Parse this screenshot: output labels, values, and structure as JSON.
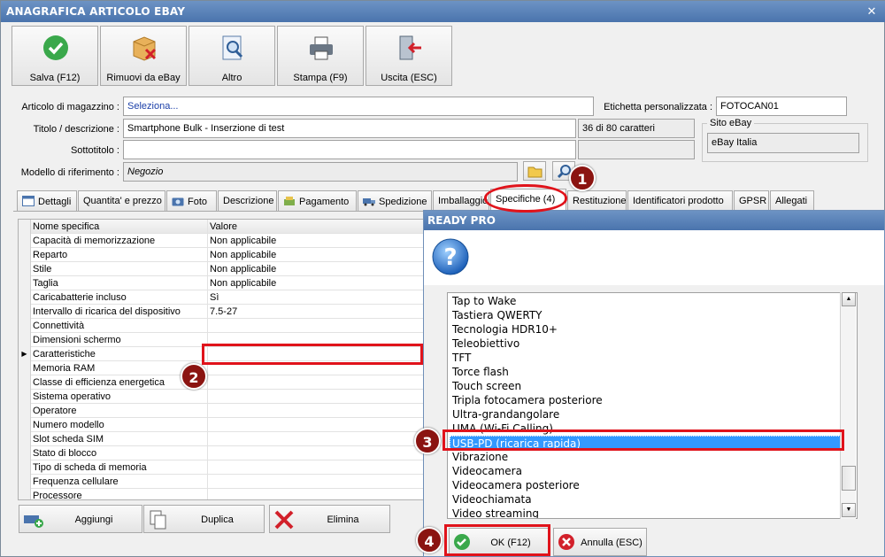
{
  "window": {
    "title": "ANAGRAFICA ARTICOLO EBAY",
    "close_glyph": "✕"
  },
  "toolbar": [
    {
      "label": "Salva (F12)",
      "icon": "save-check-icon"
    },
    {
      "label": "Rimuovi da eBay",
      "icon": "remove-box-icon"
    },
    {
      "label": "Altro",
      "icon": "document-search-icon"
    },
    {
      "label": "Stampa (F9)",
      "icon": "printer-icon"
    },
    {
      "label": "Uscita (ESC)",
      "icon": "exit-door-icon"
    }
  ],
  "form": {
    "articolo_label": "Articolo di magazzino :",
    "articolo_value": "Seleziona...",
    "etichetta_label": "Etichetta personalizzata :",
    "etichetta_value": "FOTOCAN01",
    "titolo_label": "Titolo / descrizione :",
    "titolo_value": "Smartphone Bulk - Inserzione di test",
    "char_count": "36 di 80 caratteri",
    "sito_group": "Sito eBay",
    "sito_value": "eBay Italia",
    "sottotitolo_label": "Sottotitolo :",
    "sottotitolo_value": "",
    "modello_label": "Modello di riferimento :",
    "modello_value": "Negozio"
  },
  "tabs": [
    {
      "label": "Dettagli",
      "icon": "details-icon"
    },
    {
      "label": "Quantita' e prezzo",
      "icon": ""
    },
    {
      "label": "Foto",
      "icon": "camera-icon"
    },
    {
      "label": "Descrizione",
      "icon": ""
    },
    {
      "label": "Pagamento",
      "icon": "payment-icon"
    },
    {
      "label": "Spedizione",
      "icon": "truck-icon"
    },
    {
      "label": "Imballaggio",
      "icon": ""
    },
    {
      "label": "Specifiche (4)",
      "icon": ""
    },
    {
      "label": "Restituzione",
      "icon": ""
    },
    {
      "label": "Identificatori prodotto",
      "icon": ""
    },
    {
      "label": "GPSR",
      "icon": ""
    },
    {
      "label": "Allegati",
      "icon": ""
    }
  ],
  "grid": {
    "headers": [
      "Nome specifica",
      "Valore"
    ],
    "rows": [
      [
        "Capacità di memorizzazione",
        "Non applicabile"
      ],
      [
        "Reparto",
        "Non applicabile"
      ],
      [
        "Stile",
        "Non applicabile"
      ],
      [
        "Taglia",
        "Non applicabile"
      ],
      [
        "Caricabatterie incluso",
        "Sì"
      ],
      [
        "Intervallo di ricarica del dispositivo",
        "7.5-27"
      ],
      [
        "Connettività",
        ""
      ],
      [
        "Dimensioni schermo",
        ""
      ],
      [
        "Caratteristiche",
        ""
      ],
      [
        "Memoria RAM",
        ""
      ],
      [
        "Classe di efficienza energetica",
        ""
      ],
      [
        "Sistema operativo",
        ""
      ],
      [
        "Operatore",
        ""
      ],
      [
        "Numero modello",
        ""
      ],
      [
        "Slot scheda SIM",
        ""
      ],
      [
        "Stato di blocco",
        ""
      ],
      [
        "Tipo di scheda di memoria",
        ""
      ],
      [
        "Frequenza cellulare",
        ""
      ],
      [
        "Processore",
        ""
      ]
    ],
    "current_row_marker": "▶"
  },
  "bottom_buttons": [
    {
      "label": "Aggiungi",
      "icon": "add-row-icon"
    },
    {
      "label": "Duplica",
      "icon": "duplicate-icon"
    },
    {
      "label": "Elimina",
      "icon": "delete-x-icon"
    }
  ],
  "dialog": {
    "title": "READY PRO",
    "icon": "question-icon",
    "items": [
      "Tap to Wake",
      "Tastiera QWERTY",
      "Tecnologia HDR10+",
      "Teleobiettivo",
      "TFT",
      "Torce flash",
      "Touch screen",
      "Tripla fotocamera posteriore",
      "Ultra-grandangolare",
      "UMA (Wi-Fi Calling)",
      "USB-PD (ricarica rapida)",
      "Vibrazione",
      "Videocamera",
      "Videocamera posteriore",
      "Videochiamata",
      "Video streaming"
    ],
    "selected": "USB-PD (ricarica rapida)",
    "ok_label": "OK (F12)",
    "cancel_label": "Annulla (ESC)"
  },
  "annotations": [
    "1",
    "2",
    "3",
    "4"
  ],
  "colors": {
    "title_bar": "#4a74ad",
    "highlight": "#e0131b",
    "badge": "#8b1411",
    "selection": "#3399ff"
  }
}
